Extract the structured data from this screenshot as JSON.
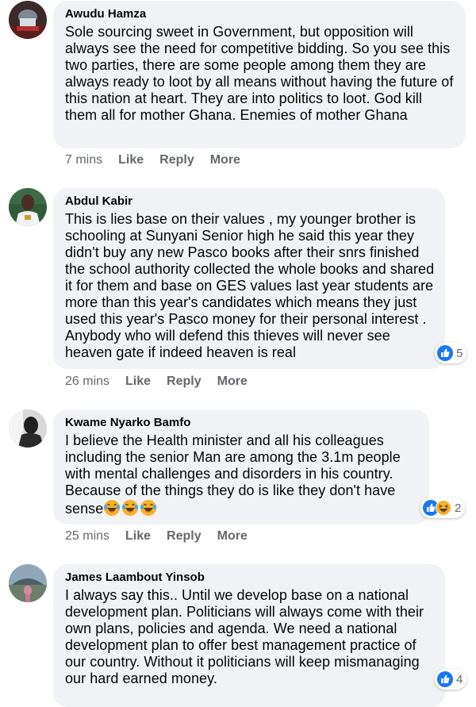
{
  "comments": [
    {
      "author": "Awudu Hamza",
      "text": "Sole sourcing sweet in Government, but opposition will always see the need for competitive bidding. So you see this two parties, there are some people among them they are always ready to loot by all means without having the future of this nation at heart. They are into politics to loot. God kill them all for mother Ghana. Enemies of mother Ghana",
      "time": "7 mins",
      "like": "Like",
      "reply": "Reply",
      "more": "More"
    },
    {
      "author": "Abdul Kabir",
      "text": "This is lies base on their values , my younger brother is schooling at Sunyani Senior high he said this year they didn't buy any new Pasco books after their snrs finished the school authority collected the whole books and shared it for them and base on GES values last year students are more than this year's candidates which means they just used this year's Pasco money for their personal interest . Anybody who will defend this thieves will never see heaven gate if indeed heaven is real",
      "time": "26 mins",
      "like": "Like",
      "reply": "Reply",
      "more": "More",
      "reaction_count": "5",
      "reaction_icons": [
        "like-icon"
      ]
    },
    {
      "author": "Kwame Nyarko Bamfo",
      "text": "I believe the Health minister and all his colleagues including the senior Man are among the 3.1m people with mental challenges and disorders in his country. Because of the things they do is like they don't have sense",
      "emoji": [
        "laughing-tears-emoji",
        "laughing-tears-emoji",
        "laughing-tears-emoji"
      ],
      "time": "25 mins",
      "like": "Like",
      "reply": "Reply",
      "more": "More",
      "reaction_count": "2",
      "reaction_icons": [
        "like-icon",
        "haha-icon"
      ]
    },
    {
      "author": "James Laambout Yinsob",
      "text": "I always say this.. Until we develop base on a national development plan. Politicians will always come with their own plans, policies and agenda. We need a national development plan to offer best management practice of our country. Without it politicians will keep mismanaging our hard earned money.",
      "reaction_count": "4",
      "reaction_icons": [
        "like-icon"
      ]
    }
  ],
  "colors": {
    "bubble": "#f0f2f5",
    "meta_text": "#65676b",
    "like_blue": "#1877f2",
    "haha_yellow": "#f7b125"
  }
}
